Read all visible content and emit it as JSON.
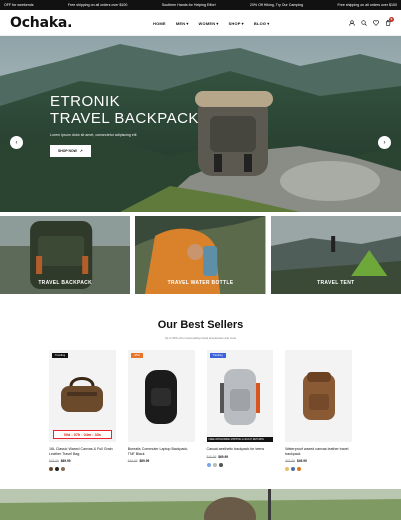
{
  "ticker": {
    "items": [
      "OFF for weekends",
      "Free shipping on all orders over $100",
      "Southern Hands for Helping Effort",
      "20% Off Hiking, Try Our Camping",
      "Free shipping on all orders over $100"
    ]
  },
  "header": {
    "logo": "Ochaka.",
    "nav": [
      "HOME",
      "MEN",
      "WOMEN",
      "SHOP",
      "BLOG"
    ],
    "cart_count": "0"
  },
  "hero": {
    "title_line1": "ETRONIK",
    "title_line2": "TRAVEL BACKPACK",
    "subtitle": "Lorem ipsum dolor sit amet, consectetur adipiscing elit",
    "cta": "SHOP NOW"
  },
  "categories": [
    {
      "label": "TRAVEL BACKPACK"
    },
    {
      "label": "TRAVEL WATER BOTTLE"
    },
    {
      "label": "TRAVEL TENT"
    }
  ],
  "best_sellers": {
    "title": "Our Best Sellers",
    "subtitle": "Up to 50% off on best-selling travel accessories and more"
  },
  "products": [
    {
      "badge": "Trending",
      "badge_color": "#111111",
      "countdown": "00d : 07h : 04m : 33s",
      "name": "16L Classic Waxed Canvas & Full Grain Leather Travel Bag",
      "old_price": "$49.99",
      "price": "$69.99",
      "swatches": [
        "#6b4a2b",
        "#222222",
        "#8a6b50"
      ]
    },
    {
      "badge": "-25%",
      "badge_color": "#e8742a",
      "name": "Borealis Commuter Laptop Backpack, TNF Black",
      "old_price": "$49.99",
      "price": "$69.99",
      "swatches": []
    },
    {
      "badge": "Trending",
      "badge_color": "#3b62d6",
      "strip": "FREE WORLDWIDE SHIPPING & 30-DAY RETURNS",
      "name": "Casual aesthetic backpack for teens",
      "old_price": "$49.99",
      "price": "$69.99",
      "swatches": [
        "#7aa5e8",
        "#bbbbbb",
        "#555555"
      ]
    },
    {
      "badge": "",
      "badge_color": "#111111",
      "name": "Waterproof waxed canvas leather travel backpack",
      "old_price": "$69.99",
      "price": "$49.99",
      "swatches": [
        "#e8c26a",
        "#4a6fa5",
        "#d9761f"
      ]
    }
  ]
}
